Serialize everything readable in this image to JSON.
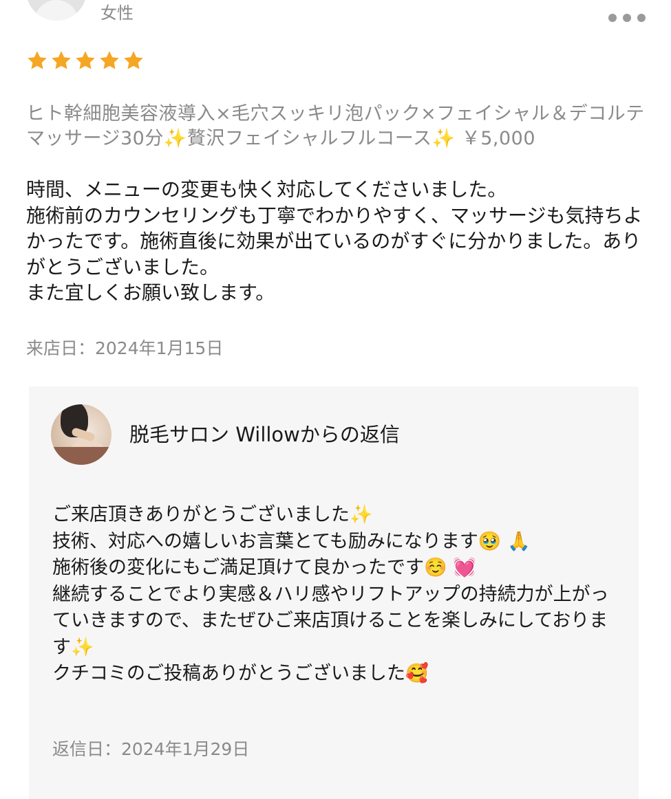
{
  "reviewer": {
    "gender": "女性",
    "avatar_icon": "user-silhouette-icon"
  },
  "more_icon": "more-dots-icon",
  "rating": {
    "stars": 5,
    "max": 5,
    "color": "#f5a623"
  },
  "review": {
    "menu": "ヒト幹細胞美容液導入×毛穴スッキリ泡パック×フェイシャル＆デコルテマッサージ30分✨贅沢フェイシャルフルコース✨ ￥5,000",
    "body": "時間、メニューの変更も快く対応してくださいました。\n施術前のカウンセリングも丁寧でわかりやすく、マッサージも気持ちよかったです。施術直後に効果が出ているのがすぐに分かりました。ありがとうございました。\nまた宜しくお願い致します。",
    "visit_date": "来店日：2024年1月15日"
  },
  "reply": {
    "title": "脱毛サロン Willowからの返信",
    "avatar": "salon-facial-photo",
    "body": "ご来店頂きありがとうございました✨\n技術、対応への嬉しいお言葉とても励みになります🥹 🙏\n施術後の変化にもご満足頂けて良かったです☺️ 💓\n継続することでより実感＆ハリ感やリフトアップの持続力が上がっていきますので、またぜひご来店頂けることを楽しみにしております✨\nクチコミのご投稿ありがとうございました🥰",
    "date": "返信日：2024年1月29日"
  }
}
